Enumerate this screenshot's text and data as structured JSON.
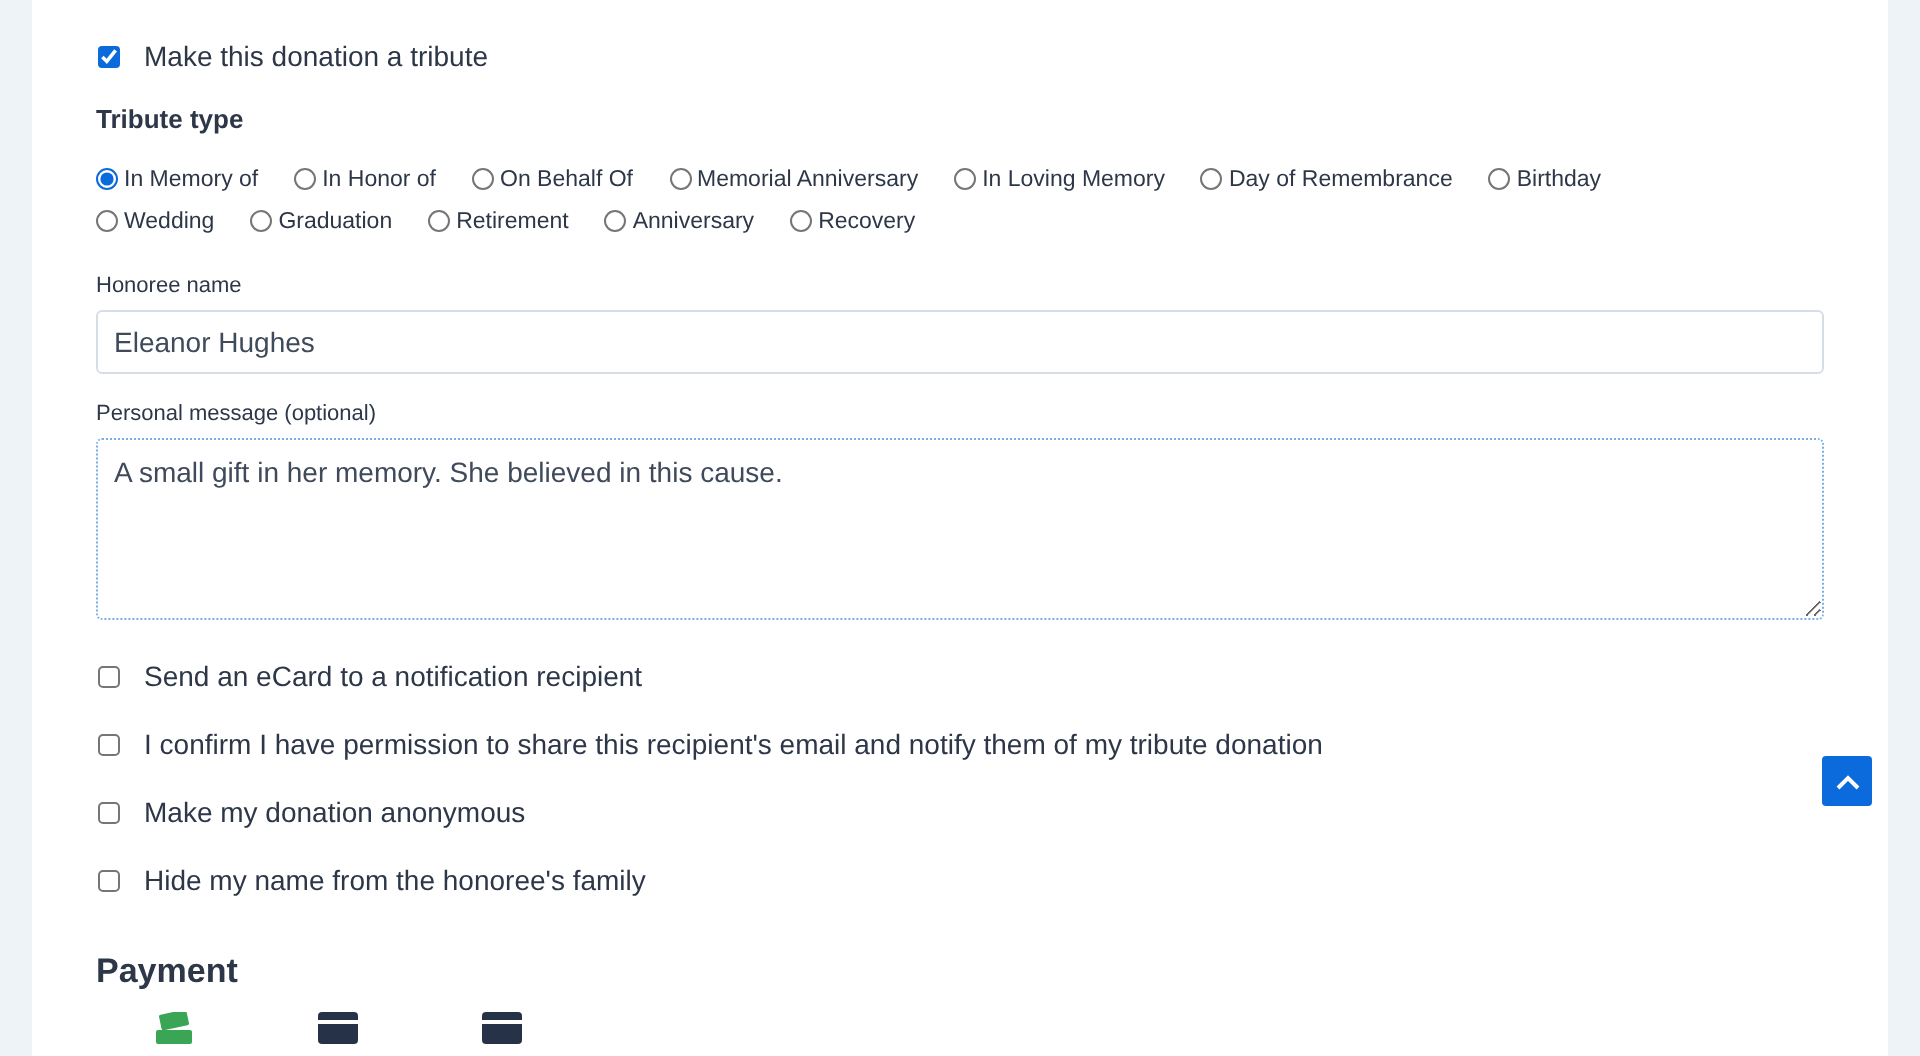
{
  "tribute_toggle": {
    "label": "Make this donation a tribute",
    "checked": true
  },
  "tribute_type": {
    "heading": "Tribute type",
    "options": [
      {
        "label": "In Memory of",
        "selected": true
      },
      {
        "label": "In Honor of",
        "selected": false
      },
      {
        "label": "On Behalf Of",
        "selected": false
      },
      {
        "label": "Memorial Anniversary",
        "selected": false
      },
      {
        "label": "In Loving Memory",
        "selected": false
      },
      {
        "label": "Day of Remembrance",
        "selected": false
      },
      {
        "label": "Birthday",
        "selected": false
      },
      {
        "label": "Wedding",
        "selected": false
      },
      {
        "label": "Graduation",
        "selected": false
      },
      {
        "label": "Retirement",
        "selected": false
      },
      {
        "label": "Anniversary",
        "selected": false
      },
      {
        "label": "Recovery",
        "selected": false
      }
    ]
  },
  "honoree_name": {
    "label": "Honoree name",
    "value": "Eleanor Hughes"
  },
  "personal_message": {
    "label": "Personal message (optional)",
    "value": "A small gift in her memory. She believed in this cause.",
    "focused": true
  },
  "options": [
    {
      "label": "Send an eCard to a notification recipient",
      "checked": false
    },
    {
      "label": "I confirm I have permission to share this recipient's email and notify them of my tribute donation",
      "checked": false
    },
    {
      "label": "Make my donation anonymous",
      "checked": false
    },
    {
      "label": "Hide my name from the honoree's family",
      "checked": false
    }
  ],
  "payment": {
    "heading": "Payment",
    "methods": [
      {
        "kind": "cash"
      },
      {
        "kind": "card"
      },
      {
        "kind": "card"
      }
    ]
  }
}
